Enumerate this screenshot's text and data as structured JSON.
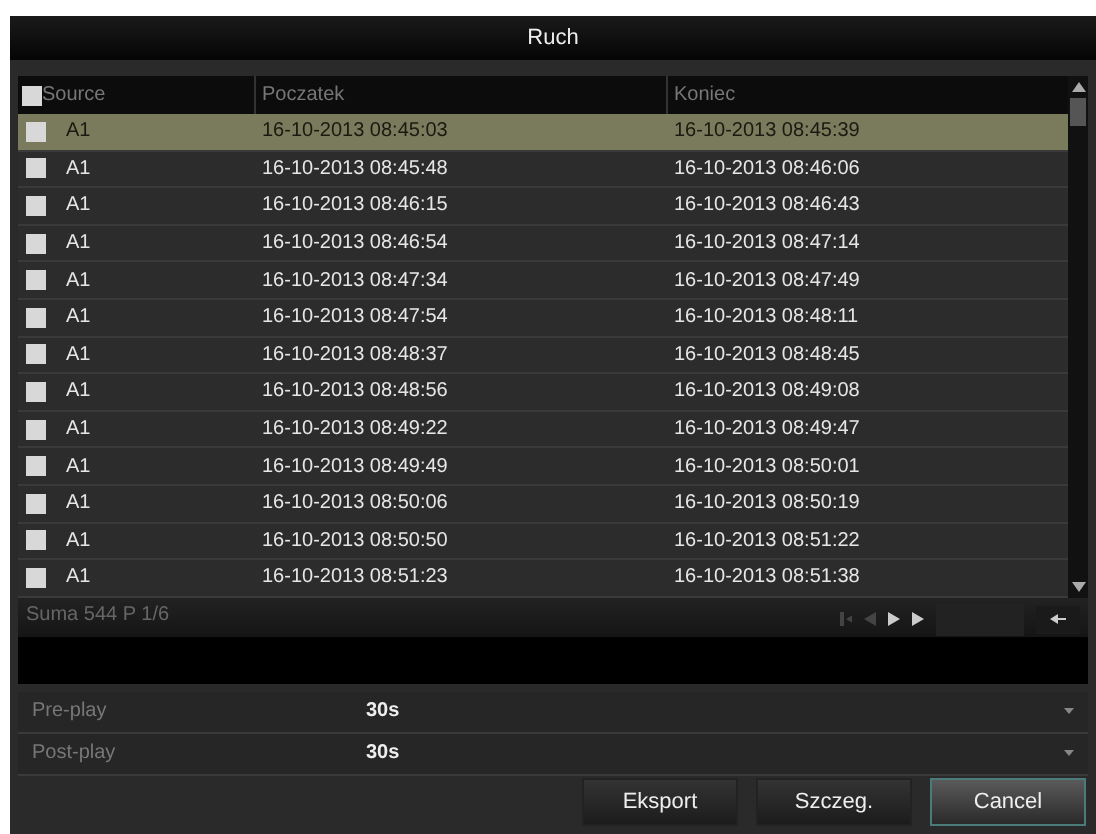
{
  "window": {
    "title": "Ruch"
  },
  "table": {
    "columns": [
      "Source",
      "Poczatek",
      "Koniec"
    ],
    "all_checked": false,
    "rows": [
      {
        "source": "A1",
        "start": "16-10-2013 08:45:03",
        "end": "16-10-2013 08:45:39",
        "checked": false,
        "selected": true
      },
      {
        "source": "A1",
        "start": "16-10-2013 08:45:48",
        "end": "16-10-2013 08:46:06",
        "checked": false,
        "selected": false
      },
      {
        "source": "A1",
        "start": "16-10-2013 08:46:15",
        "end": "16-10-2013 08:46:43",
        "checked": false,
        "selected": false
      },
      {
        "source": "A1",
        "start": "16-10-2013 08:46:54",
        "end": "16-10-2013 08:47:14",
        "checked": false,
        "selected": false
      },
      {
        "source": "A1",
        "start": "16-10-2013 08:47:34",
        "end": "16-10-2013 08:47:49",
        "checked": false,
        "selected": false
      },
      {
        "source": "A1",
        "start": "16-10-2013 08:47:54",
        "end": "16-10-2013 08:48:11",
        "checked": false,
        "selected": false
      },
      {
        "source": "A1",
        "start": "16-10-2013 08:48:37",
        "end": "16-10-2013 08:48:45",
        "checked": false,
        "selected": false
      },
      {
        "source": "A1",
        "start": "16-10-2013 08:48:56",
        "end": "16-10-2013 08:49:08",
        "checked": false,
        "selected": false
      },
      {
        "source": "A1",
        "start": "16-10-2013 08:49:22",
        "end": "16-10-2013 08:49:47",
        "checked": false,
        "selected": false
      },
      {
        "source": "A1",
        "start": "16-10-2013 08:49:49",
        "end": "16-10-2013 08:50:01",
        "checked": false,
        "selected": false
      },
      {
        "source": "A1",
        "start": "16-10-2013 08:50:06",
        "end": "16-10-2013 08:50:19",
        "checked": false,
        "selected": false
      },
      {
        "source": "A1",
        "start": "16-10-2013 08:50:50",
        "end": "16-10-2013 08:51:22",
        "checked": false,
        "selected": false
      },
      {
        "source": "A1",
        "start": "16-10-2013 08:51:23",
        "end": "16-10-2013 08:51:38",
        "checked": false,
        "selected": false
      }
    ]
  },
  "pagination": {
    "summary": "Suma 544 P 1/6",
    "first_disabled": true,
    "prev_disabled": true,
    "next_disabled": false,
    "last_disabled": false
  },
  "settings": [
    {
      "label": "Pre-play",
      "value": "30s"
    },
    {
      "label": "Post-play",
      "value": "30s"
    }
  ],
  "buttons": [
    {
      "label": "Eksport",
      "kind": "normal"
    },
    {
      "label": "Szczeg.",
      "kind": "normal"
    },
    {
      "label": "Cancel",
      "kind": "primary"
    }
  ]
}
